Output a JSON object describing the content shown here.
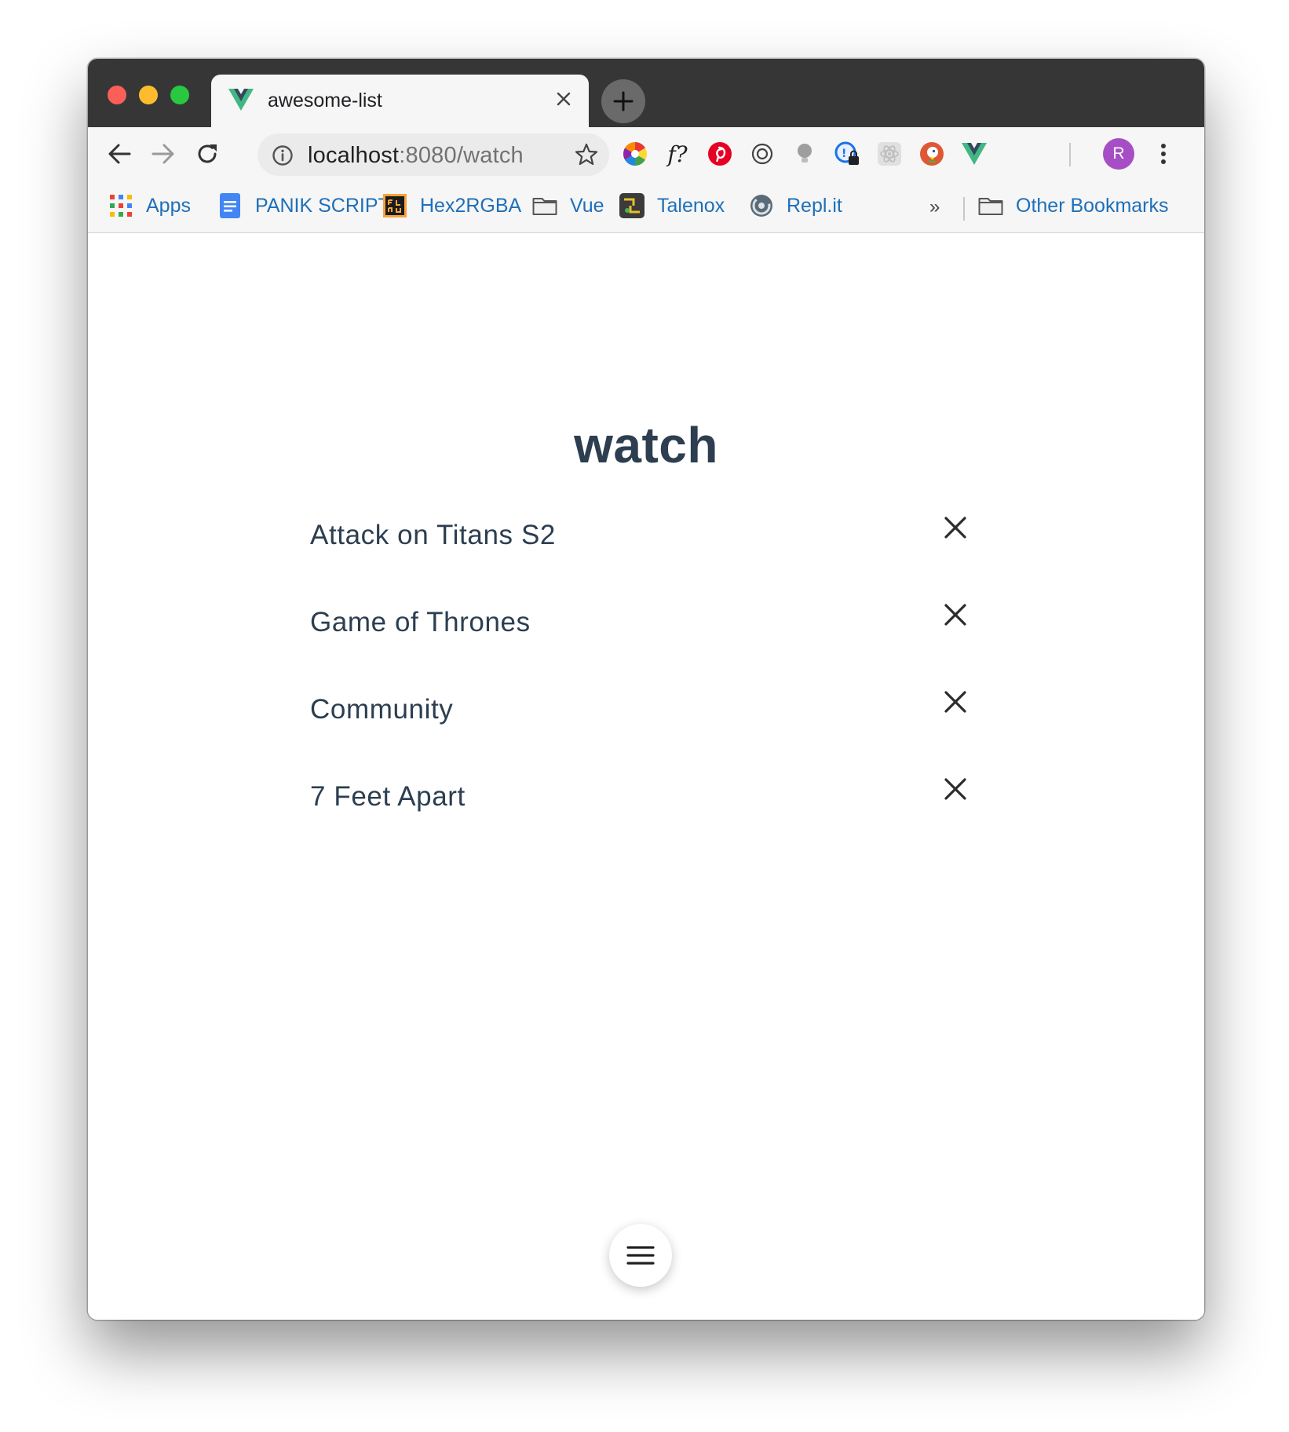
{
  "tab": {
    "title": "awesome-list",
    "favicon": "vue-logo-icon"
  },
  "toolbar": {
    "url_host": "localhost",
    "url_path": ":8080/watch",
    "extensions": [
      "color-wheel-icon",
      "function-icon",
      "pinterest-icon",
      "openai-icon",
      "lightbulb-icon",
      "password-lock-icon",
      "react-devtools-icon",
      "duckduckgo-icon",
      "vue-devtools-icon"
    ],
    "avatar_initial": "R"
  },
  "bookmarks": {
    "items": [
      {
        "label": "Apps",
        "icon": "apps-grid-icon"
      },
      {
        "label": "PANIK SCRIPT",
        "icon": "docs-icon"
      },
      {
        "label": "Hex2RGBA",
        "icon": "hex2rgba-icon"
      },
      {
        "label": "Vue",
        "icon": "folder-icon"
      },
      {
        "label": "Talenox",
        "icon": "talenox-icon"
      },
      {
        "label": "Repl.it",
        "icon": "replit-icon"
      }
    ],
    "more": "»",
    "other": "Other Bookmarks"
  },
  "page": {
    "title": "watch",
    "items": [
      {
        "label": "Attack on Titans S2"
      },
      {
        "label": "Game of Thrones"
      },
      {
        "label": "Community"
      },
      {
        "label": "7 Feet Apart"
      }
    ]
  },
  "colors": {
    "heading": "#2c3e50",
    "item_text": "#2c3e50",
    "bookmark_link": "#1f6fb8",
    "tab_bar": "#363636",
    "avatar": "#a64ec4"
  }
}
